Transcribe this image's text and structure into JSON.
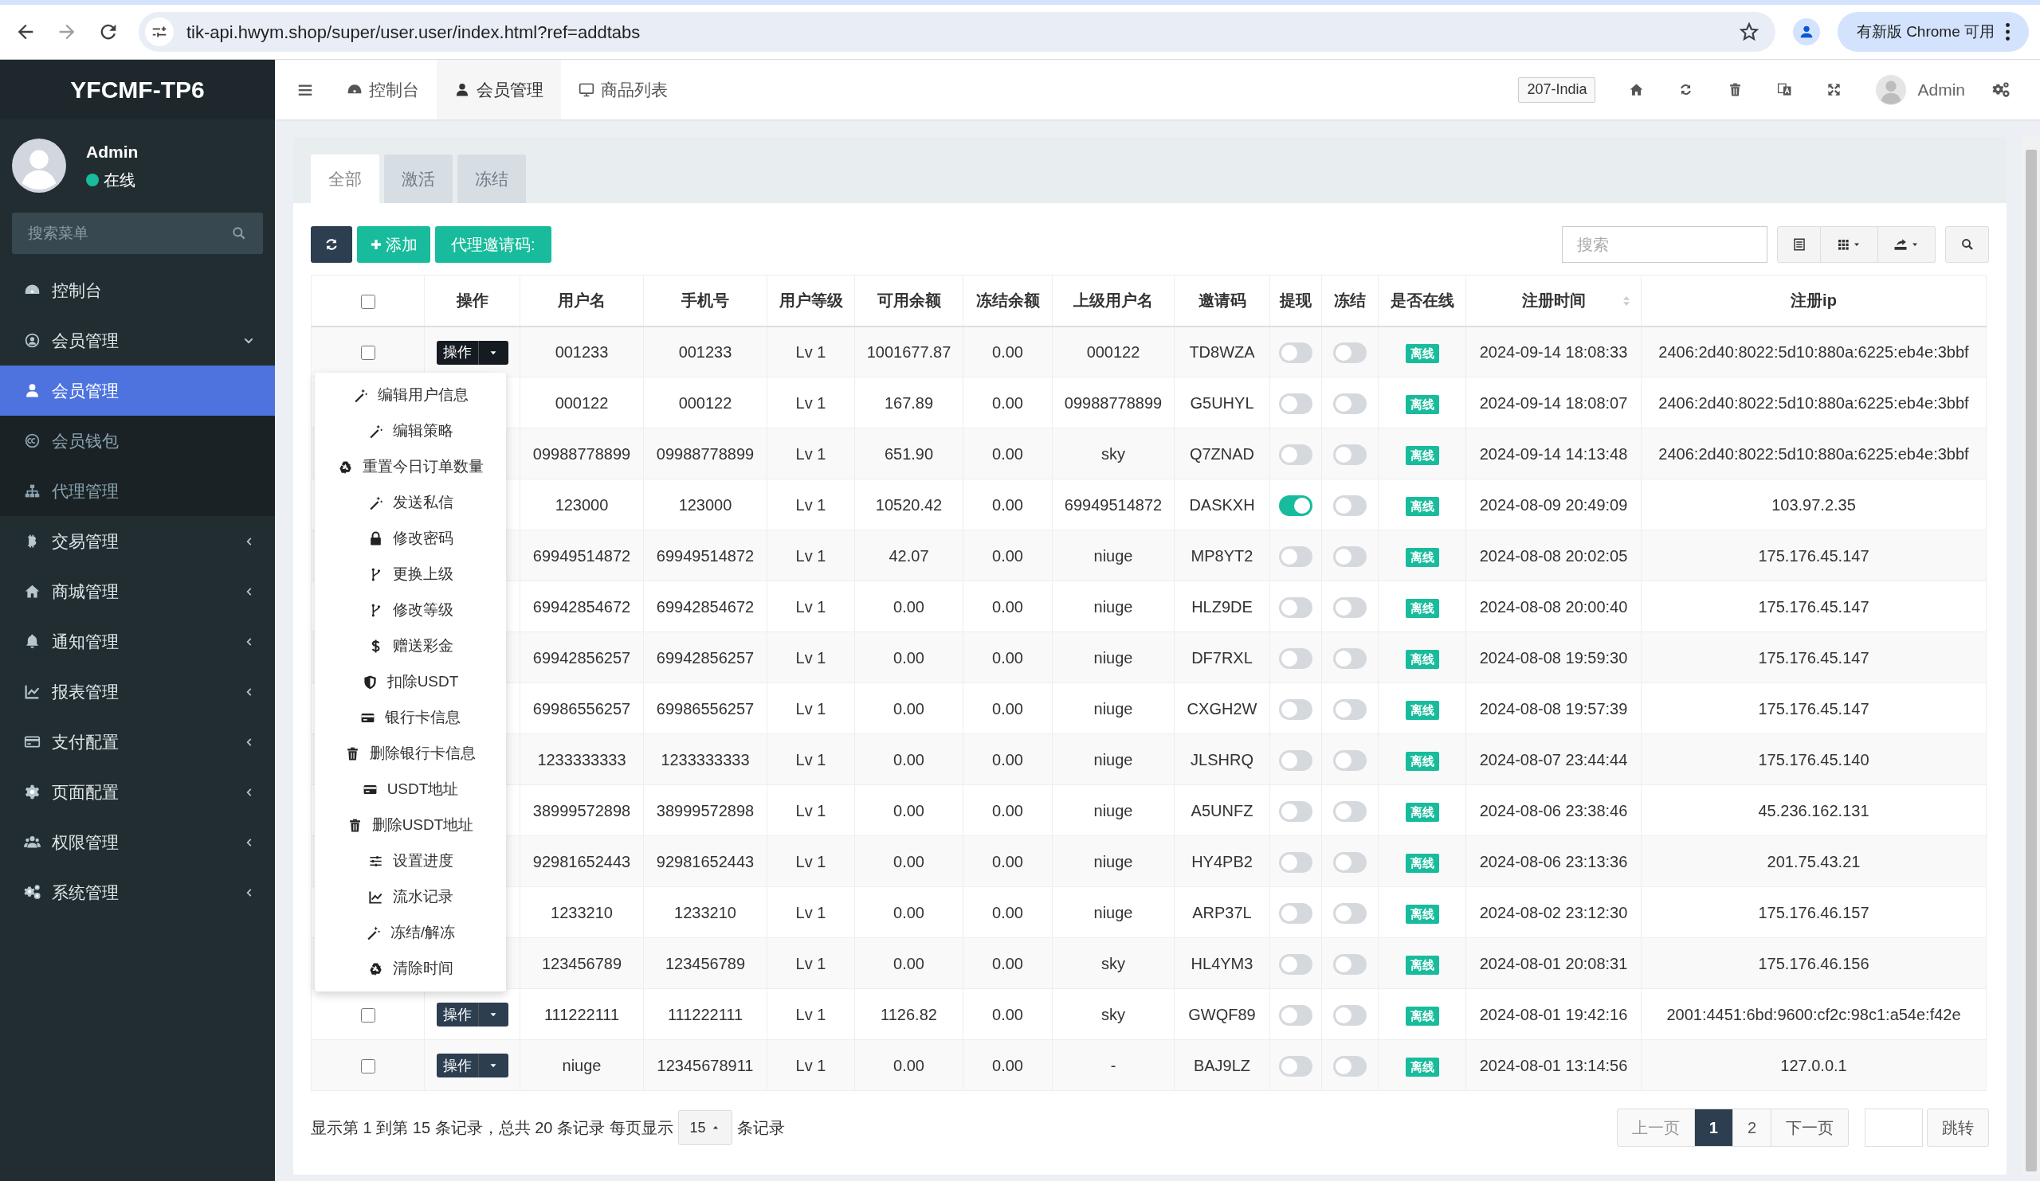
{
  "browser": {
    "url": "tik-api.hwym.shop/super/user.user/index.html?ref=addtabs",
    "update_label": "有新版 Chrome 可用"
  },
  "sidebar": {
    "logo": "YFCMF-TP6",
    "user": {
      "name": "Admin",
      "status": "在线"
    },
    "search": {
      "placeholder": "搜索菜单"
    },
    "items": [
      {
        "label": "控制台"
      },
      {
        "label": "会员管理",
        "expanded": true,
        "children": [
          {
            "label": "会员管理",
            "selected": true
          },
          {
            "label": "会员钱包",
            "selected": false
          },
          {
            "label": "代理管理",
            "selected": false
          }
        ]
      },
      {
        "label": "交易管理",
        "expanded": false
      },
      {
        "label": "商城管理",
        "expanded": false
      },
      {
        "label": "通知管理",
        "expanded": false
      },
      {
        "label": "报表管理",
        "expanded": false
      },
      {
        "label": "支付配置",
        "expanded": false
      },
      {
        "label": "页面配置",
        "expanded": false
      },
      {
        "label": "权限管理",
        "expanded": false
      },
      {
        "label": "系统管理",
        "expanded": false
      }
    ]
  },
  "header": {
    "tabs": [
      {
        "label": "控制台",
        "selected": false
      },
      {
        "label": "会员管理",
        "selected": true
      },
      {
        "label": "商品列表",
        "selected": false
      }
    ],
    "region": "207-India",
    "user": "Admin"
  },
  "filter_tabs": [
    {
      "label": "全部",
      "selected": true
    },
    {
      "label": "激活",
      "selected": false
    },
    {
      "label": "冻结",
      "selected": false
    }
  ],
  "toolbar": {
    "add_label": "添加",
    "invite_label": "代理邀请码:",
    "search_placeholder": "搜索"
  },
  "table": {
    "select_all": {
      "checked": false
    },
    "columns": [
      "操作",
      "用户名",
      "手机号",
      "用户等级",
      "可用余额",
      "冻结余额",
      "上级用户名",
      "邀请码",
      "提现",
      "冻结",
      "是否在线",
      "注册时间",
      "注册ip"
    ],
    "rows": [
      {
        "checked": false,
        "cells": [
          {
            "kind": "action",
            "label": "操作",
            "open": true
          },
          "001233",
          "001233",
          "Lv 1",
          "1001677.87",
          "0.00",
          "000122",
          "TD8WZA",
          {
            "kind": "toggle",
            "on": false
          },
          {
            "kind": "toggle",
            "on": false
          },
          {
            "kind": "badge",
            "label": "离线"
          },
          "2024-09-14 18:08:33",
          "2406:2d40:8022:5d10:880a:6225:eb4e:3bbf"
        ]
      },
      {
        "cells": [
          "",
          "000122",
          "000122",
          "Lv 1",
          "167.89",
          "0.00",
          "09988778899",
          "G5UHYL",
          {
            "kind": "toggle",
            "on": false
          },
          {
            "kind": "toggle",
            "on": false
          },
          {
            "kind": "badge",
            "label": "离线"
          },
          "2024-09-14 18:08:07",
          "2406:2d40:8022:5d10:880a:6225:eb4e:3bbf"
        ]
      },
      {
        "cells": [
          "",
          "09988778899",
          "09988778899",
          "Lv 1",
          "651.90",
          "0.00",
          "sky",
          "Q7ZNAD",
          {
            "kind": "toggle",
            "on": false
          },
          {
            "kind": "toggle",
            "on": false
          },
          {
            "kind": "badge",
            "label": "离线"
          },
          "2024-09-14 14:13:48",
          "2406:2d40:8022:5d10:880a:6225:eb4e:3bbf"
        ]
      },
      {
        "cells": [
          "",
          "123000",
          "123000",
          "Lv 1",
          "10520.42",
          "0.00",
          "69949514872",
          "DASKXH",
          {
            "kind": "toggle",
            "on": true
          },
          {
            "kind": "toggle",
            "on": false
          },
          {
            "kind": "badge",
            "label": "离线"
          },
          "2024-08-09 20:49:09",
          "103.97.2.35"
        ]
      },
      {
        "cells": [
          "",
          "69949514872",
          "69949514872",
          "Lv 1",
          "42.07",
          "0.00",
          "niuge",
          "MP8YT2",
          {
            "kind": "toggle",
            "on": false
          },
          {
            "kind": "toggle",
            "on": false
          },
          {
            "kind": "badge",
            "label": "离线"
          },
          "2024-08-08 20:02:05",
          "175.176.45.147"
        ]
      },
      {
        "cells": [
          "",
          "69942854672",
          "69942854672",
          "Lv 1",
          "0.00",
          "0.00",
          "niuge",
          "HLZ9DE",
          {
            "kind": "toggle",
            "on": false
          },
          {
            "kind": "toggle",
            "on": false
          },
          {
            "kind": "badge",
            "label": "离线"
          },
          "2024-08-08 20:00:40",
          "175.176.45.147"
        ]
      },
      {
        "cells": [
          "",
          "69942856257",
          "69942856257",
          "Lv 1",
          "0.00",
          "0.00",
          "niuge",
          "DF7RXL",
          {
            "kind": "toggle",
            "on": false
          },
          {
            "kind": "toggle",
            "on": false
          },
          {
            "kind": "badge",
            "label": "离线"
          },
          "2024-08-08 19:59:30",
          "175.176.45.147"
        ]
      },
      {
        "cells": [
          "",
          "69986556257",
          "69986556257",
          "Lv 1",
          "0.00",
          "0.00",
          "niuge",
          "CXGH2W",
          {
            "kind": "toggle",
            "on": false
          },
          {
            "kind": "toggle",
            "on": false
          },
          {
            "kind": "badge",
            "label": "离线"
          },
          "2024-08-08 19:57:39",
          "175.176.45.147"
        ]
      },
      {
        "cells": [
          "",
          "1233333333",
          "1233333333",
          "Lv 1",
          "0.00",
          "0.00",
          "niuge",
          "JLSHRQ",
          {
            "kind": "toggle",
            "on": false
          },
          {
            "kind": "toggle",
            "on": false
          },
          {
            "kind": "badge",
            "label": "离线"
          },
          "2024-08-07 23:44:44",
          "175.176.45.140"
        ]
      },
      {
        "cells": [
          "",
          "38999572898",
          "38999572898",
          "Lv 1",
          "0.00",
          "0.00",
          "niuge",
          "A5UNFZ",
          {
            "kind": "toggle",
            "on": false
          },
          {
            "kind": "toggle",
            "on": false
          },
          {
            "kind": "badge",
            "label": "离线"
          },
          "2024-08-06 23:38:46",
          "45.236.162.131"
        ]
      },
      {
        "cells": [
          "",
          "92981652443",
          "92981652443",
          "Lv 1",
          "0.00",
          "0.00",
          "niuge",
          "HY4PB2",
          {
            "kind": "toggle",
            "on": false
          },
          {
            "kind": "toggle",
            "on": false
          },
          {
            "kind": "badge",
            "label": "离线"
          },
          "2024-08-06 23:13:36",
          "201.75.43.21"
        ]
      },
      {
        "cells": [
          "",
          "1233210",
          "1233210",
          "Lv 1",
          "0.00",
          "0.00",
          "niuge",
          "ARP37L",
          {
            "kind": "toggle",
            "on": false
          },
          {
            "kind": "toggle",
            "on": false
          },
          {
            "kind": "badge",
            "label": "离线"
          },
          "2024-08-02 23:12:30",
          "175.176.46.157"
        ]
      },
      {
        "cells": [
          "",
          "123456789",
          "123456789",
          "Lv 1",
          "0.00",
          "0.00",
          "sky",
          "HL4YM3",
          {
            "kind": "toggle",
            "on": false
          },
          {
            "kind": "toggle",
            "on": false
          },
          {
            "kind": "badge",
            "label": "离线"
          },
          "2024-08-01 20:08:31",
          "175.176.46.156"
        ]
      },
      {
        "checked": false,
        "cells": [
          {
            "kind": "action",
            "label": "操作",
            "open": false
          },
          "111222111",
          "111222111",
          "Lv 1",
          "1126.82",
          "0.00",
          "sky",
          "GWQF89",
          {
            "kind": "toggle",
            "on": false
          },
          {
            "kind": "toggle",
            "on": false
          },
          {
            "kind": "badge",
            "label": "离线"
          },
          "2024-08-01 19:42:16",
          "2001:4451:6bd:9600:cf2c:98c1:a54e:f42e"
        ]
      },
      {
        "checked": false,
        "cells": [
          {
            "kind": "action",
            "label": "操作",
            "open": false
          },
          "niuge",
          "12345678911",
          "Lv 1",
          "0.00",
          "0.00",
          "-",
          "BAJ9LZ",
          {
            "kind": "toggle",
            "on": false
          },
          {
            "kind": "toggle",
            "on": false
          },
          {
            "kind": "badge",
            "label": "离线"
          },
          "2024-08-01 13:14:56",
          "127.0.0.1"
        ]
      }
    ]
  },
  "action_menu": [
    "编辑用户信息",
    "编辑策略",
    "重置今日订单数量",
    "发送私信",
    "修改密码",
    "更换上级",
    "修改等级",
    "赠送彩金",
    "扣除USDT",
    "银行卡信息",
    "删除银行卡信息",
    "USDT地址",
    "删除USDT地址",
    "设置进度",
    "流水记录",
    "冻结/解冻",
    "清除时间"
  ],
  "footer": {
    "summary": "显示第 1 到第 15 条记录，总共 20 条记录 每页显示",
    "page_size": "15",
    "page_size_suffix": "条记录",
    "prev": "上一页",
    "pages": [
      {
        "label": "1",
        "selected": true
      },
      {
        "label": "2",
        "selected": false
      }
    ],
    "next": "下一页",
    "jump": "跳转"
  }
}
